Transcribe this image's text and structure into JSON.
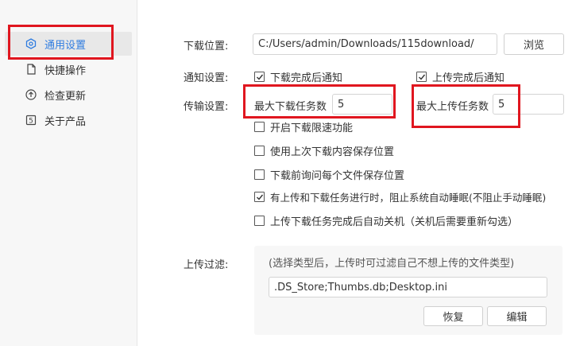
{
  "sidebar": {
    "items": [
      {
        "label": "通用设置",
        "icon": "hexagon-settings-icon",
        "active": true
      },
      {
        "label": "快捷操作",
        "icon": "document-icon",
        "active": false
      },
      {
        "label": "检查更新",
        "icon": "arrow-up-circle-icon",
        "active": false
      },
      {
        "label": "关于产品",
        "icon": "box-s-icon",
        "active": false
      }
    ]
  },
  "download_location": {
    "label": "下载位置:",
    "path": "C:/Users/admin/Downloads/115download/",
    "browse_label": "浏览"
  },
  "notification": {
    "label": "通知设置:",
    "download_complete": {
      "label": "下载完成后通知",
      "checked": true
    },
    "upload_complete": {
      "label": "上传完成后通知",
      "checked": true
    }
  },
  "transfer": {
    "label": "传输设置:",
    "max_download_label": "最大下载任务数",
    "max_download_value": "5",
    "max_upload_label": "最大上传任务数",
    "max_upload_value": "5",
    "options": [
      {
        "label": "开启下载限速功能",
        "checked": false
      },
      {
        "label": "使用上次下载内容保存位置",
        "checked": false
      },
      {
        "label": "下载前询问每个文件保存位置",
        "checked": false
      },
      {
        "label": "有上传和下载任务进行时，阻止系统自动睡眠(不阻止手动睡眠)",
        "checked": true
      },
      {
        "label": "上传下载任务完成后自动关机（关机后需要重新勾选）",
        "checked": false
      }
    ]
  },
  "upload_filter": {
    "label": "上传过滤:",
    "hint": "(选择类型后，上传时可过滤自己不想上传的文件类型)",
    "value": ".DS_Store;Thumbs.db;Desktop.ini",
    "restore_label": "恢复",
    "edit_label": "编辑"
  },
  "colors": {
    "accent": "#2f7ce0",
    "highlight": "#e0161f"
  }
}
